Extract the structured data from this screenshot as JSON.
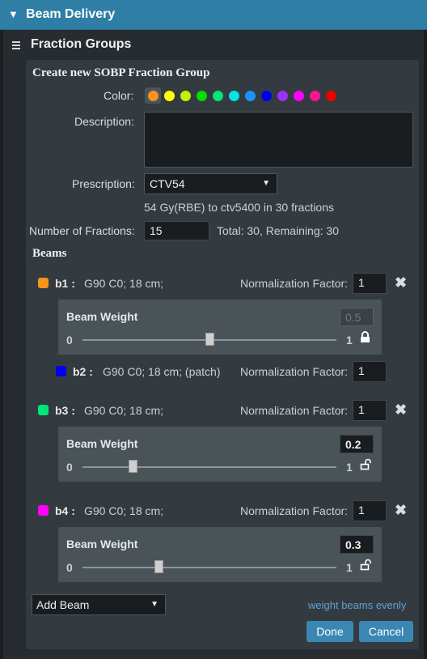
{
  "section": {
    "title": "Beam Delivery"
  },
  "fraction_groups": {
    "title": "Fraction Groups"
  },
  "form": {
    "title": "Create new SOBP Fraction Group",
    "color_label": "Color:",
    "colors": [
      "#f7941d",
      "#ffff00",
      "#c8f000",
      "#00e000",
      "#00e67a",
      "#00e6e6",
      "#1e90ff",
      "#0000ee",
      "#9b30ff",
      "#ff00ff",
      "#ff1493",
      "#ee0000"
    ],
    "description_label": "Description:",
    "description_value": "",
    "prescription_label": "Prescription:",
    "prescription_value": "CTV54",
    "prescription_detail": "54  Gy(RBE) to ctv5400 in  30 fractions",
    "fractions_label": "Number of Fractions:",
    "fractions_value": "15",
    "fractions_total": "Total: 30, Remaining: 30"
  },
  "beams_title": "Beams",
  "norm_label": "Normalization Factor:",
  "weight_title": "Beam Weight",
  "slider_min": "0",
  "slider_max": "1",
  "beams": [
    {
      "id": "b1 :",
      "desc": "G90 C0; 18 cm;",
      "color": "#f7941d",
      "norm": "1",
      "weight": "0.5",
      "weight_fraction": 0.5,
      "locked": true
    },
    {
      "id": "b2 :",
      "desc": "G90 C0; 18 cm; (patch)",
      "color": "#0000ee",
      "norm": "1"
    },
    {
      "id": "b3 :",
      "desc": "G90 C0; 18 cm;",
      "color": "#00e67a",
      "norm": "1",
      "weight": "0.2",
      "weight_fraction": 0.2,
      "locked": false
    },
    {
      "id": "b4 :",
      "desc": "G90 C0; 18 cm;",
      "color": "#ff00ff",
      "norm": "1",
      "weight": "0.3",
      "weight_fraction": 0.3,
      "locked": false
    }
  ],
  "add_beam_label": "Add Beam",
  "weight_evenly_label": "weight beams evenly",
  "done_label": "Done",
  "cancel_label": "Cancel"
}
